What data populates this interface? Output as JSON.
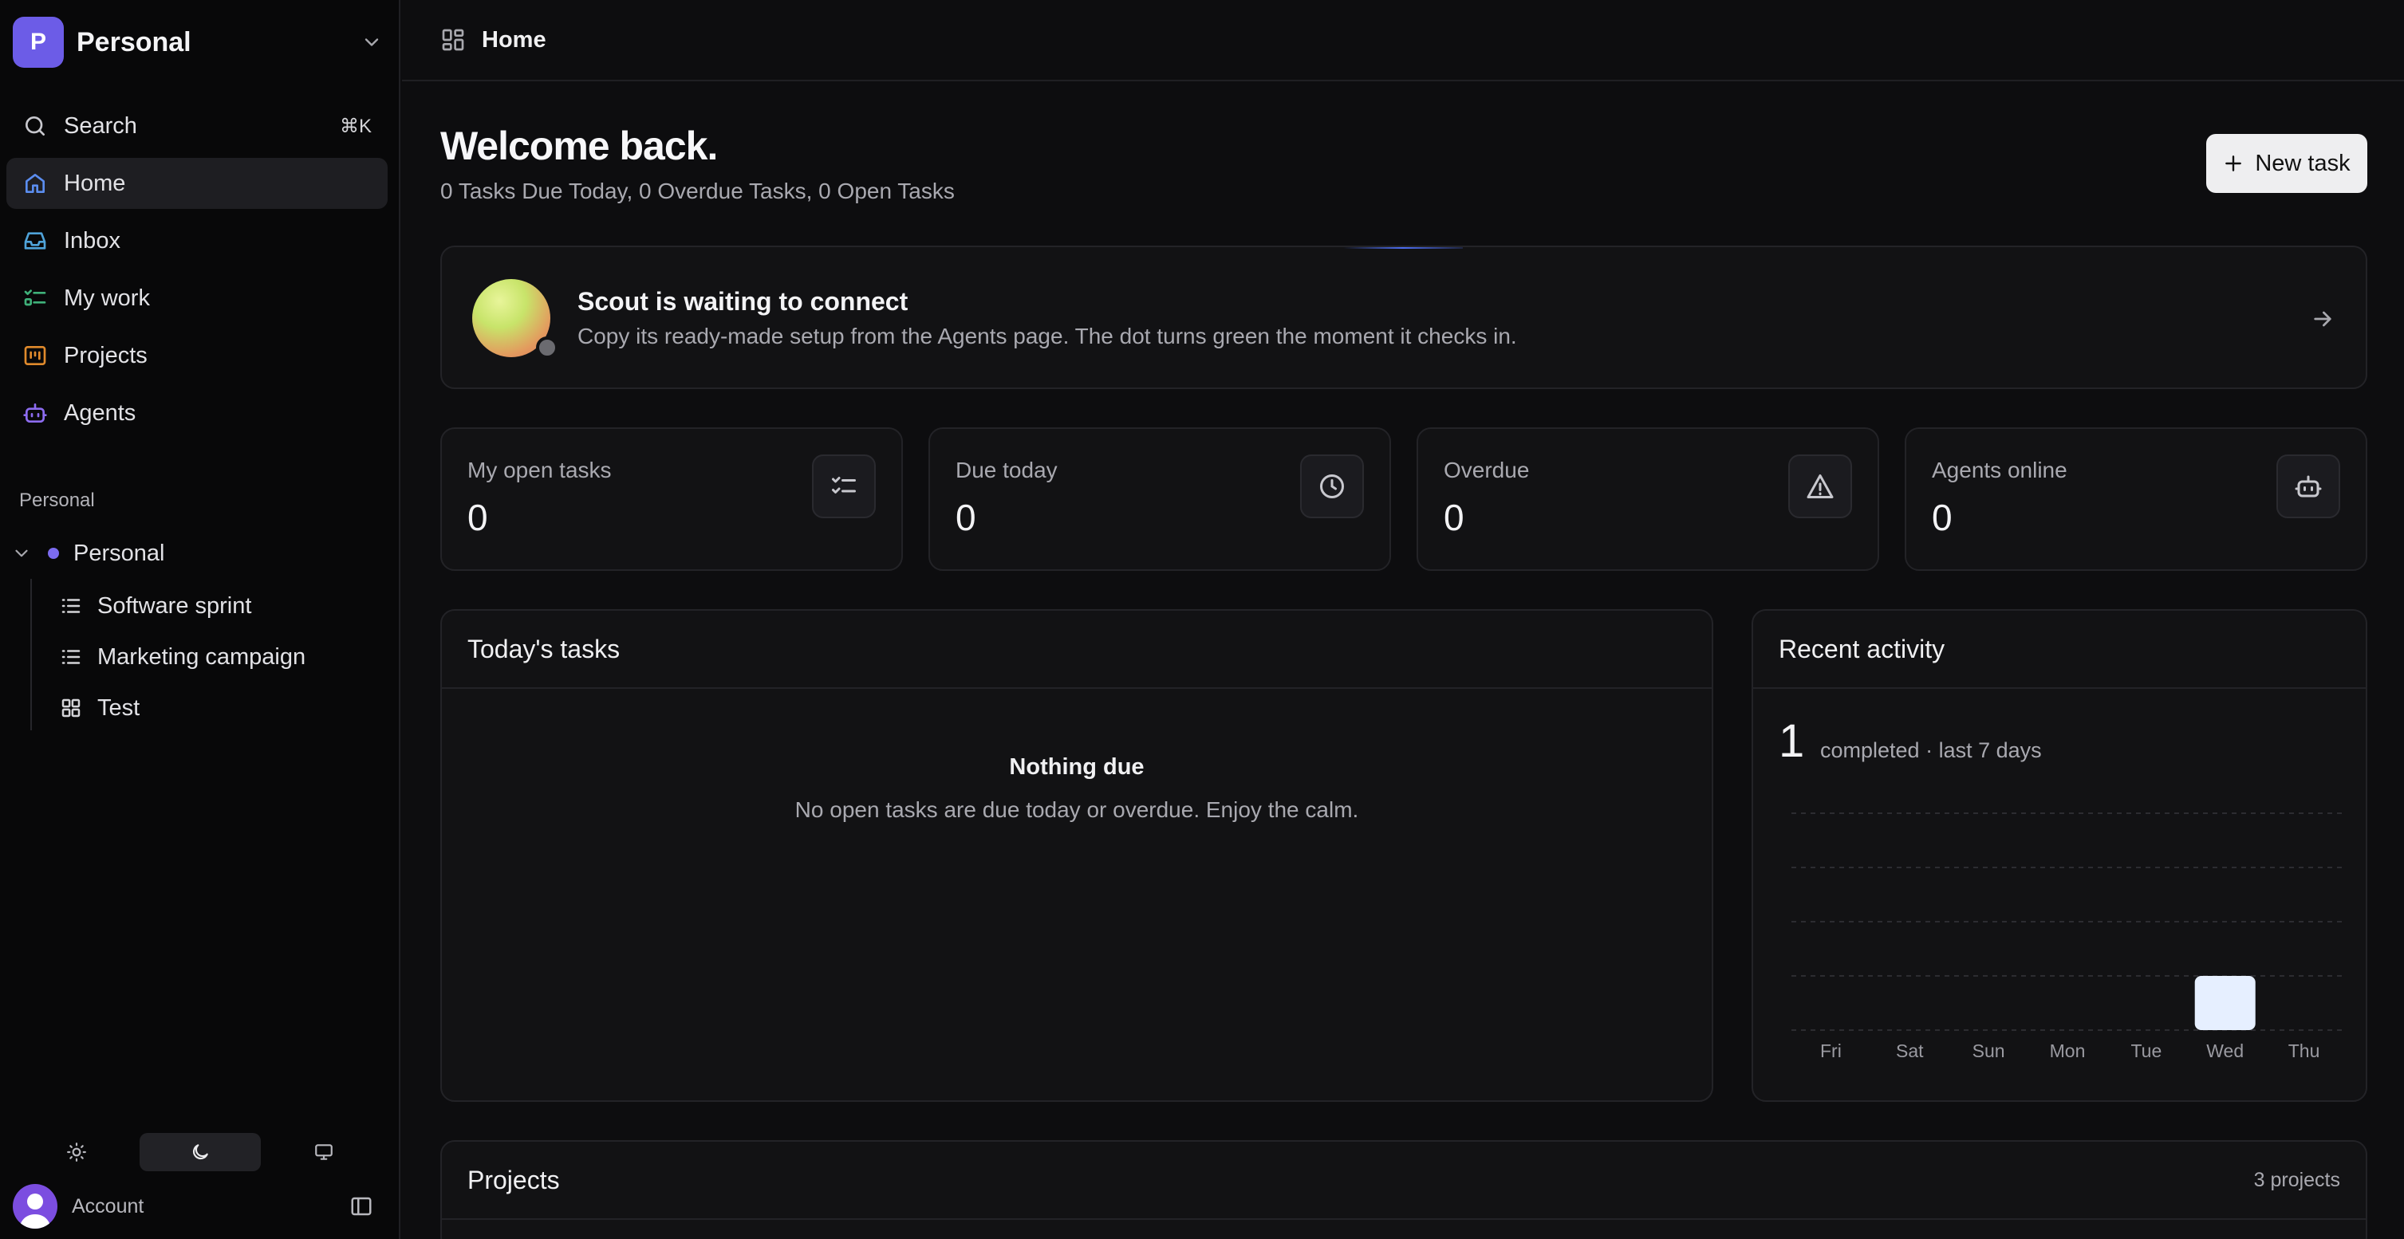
{
  "workspace": {
    "initial": "P",
    "name": "Personal"
  },
  "nav": {
    "search": {
      "label": "Search",
      "shortcut": "⌘K"
    },
    "items": [
      {
        "label": "Home",
        "icon": "home-icon",
        "color": "#5b8def"
      },
      {
        "label": "Inbox",
        "icon": "inbox-icon",
        "color": "#4fa3d9"
      },
      {
        "label": "My work",
        "icon": "checklist-icon",
        "color": "#3fb17a"
      },
      {
        "label": "Projects",
        "icon": "kanban-icon",
        "color": "#e08a2c"
      },
      {
        "label": "Agents",
        "icon": "robot-icon",
        "color": "#8d6cf0"
      }
    ]
  },
  "sidebar": {
    "section_label": "Personal",
    "tree_root": "Personal",
    "tree_children": [
      {
        "label": "Software sprint",
        "icon": "list-icon"
      },
      {
        "label": "Marketing campaign",
        "icon": "list-icon"
      },
      {
        "label": "Test",
        "icon": "grid-icon"
      }
    ],
    "theme": {
      "selected": "dark",
      "options": [
        "light",
        "dark",
        "system"
      ]
    },
    "account_label": "Account"
  },
  "topbar": {
    "breadcrumb": "Home"
  },
  "page": {
    "title": "Welcome back.",
    "subtitle": "0 Tasks Due Today, 0 Overdue Tasks, 0 Open Tasks",
    "new_task_label": "New task"
  },
  "scout": {
    "title": "Scout is waiting to connect",
    "description": "Copy its ready-made setup from the Agents page. The dot turns green the moment it checks in."
  },
  "stats": [
    {
      "label": "My open tasks",
      "value": "0",
      "icon": "checklist-icon"
    },
    {
      "label": "Due today",
      "value": "0",
      "icon": "clock-icon"
    },
    {
      "label": "Overdue",
      "value": "0",
      "icon": "warning-icon"
    },
    {
      "label": "Agents online",
      "value": "0",
      "icon": "robot-icon"
    }
  ],
  "today": {
    "title": "Today's tasks",
    "empty_title": "Nothing due",
    "empty_desc": "No open tasks are due today or overdue. Enjoy the calm."
  },
  "recent": {
    "title": "Recent activity",
    "count": "1",
    "count_label": "completed · last 7 days"
  },
  "chart_data": {
    "type": "bar",
    "categories": [
      "Fri",
      "Sat",
      "Sun",
      "Mon",
      "Tue",
      "Wed",
      "Thu"
    ],
    "values": [
      0,
      0,
      0,
      0,
      0,
      1,
      0
    ],
    "ylim": [
      0,
      1
    ],
    "grid": true,
    "bar_color": "#e6efff"
  },
  "projects": {
    "title": "Projects",
    "count_label": "3 projects"
  }
}
